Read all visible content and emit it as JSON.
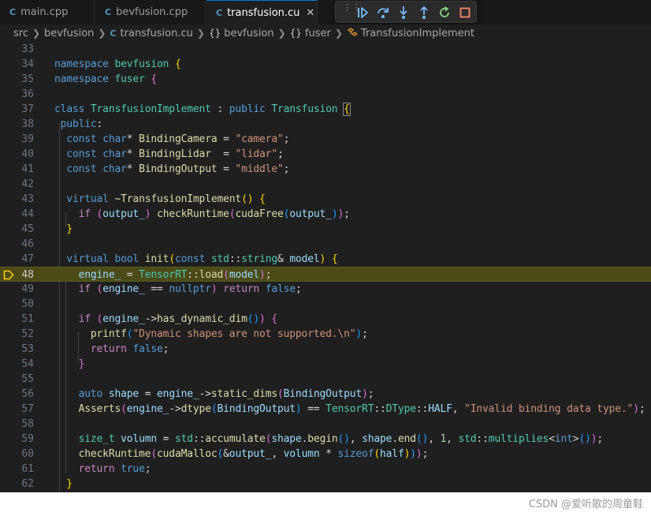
{
  "tabs": [
    {
      "label": "main.cpp",
      "icon": "c-icon",
      "active": false
    },
    {
      "label": "bevfusion.cpp",
      "icon": "c-icon",
      "active": false
    },
    {
      "label": "transfusion.cu",
      "icon": "c-icon",
      "active": true
    }
  ],
  "tab_close_glyph": "✕",
  "tab_icon_glyph": "C",
  "debug_toolbar": [
    "drag-handle-icon",
    "continue-icon",
    "step-over-icon",
    "step-into-icon",
    "step-out-icon",
    "restart-icon",
    "stop-icon"
  ],
  "breadcrumb": {
    "items": [
      "src",
      "bevfusion",
      "transfusion.cu",
      "bevfusion",
      "fuser",
      "TransfusionImplement"
    ],
    "namespace_glyph": "{}"
  },
  "editor": {
    "current_line": 48,
    "breakpoint_line": 48,
    "lines": [
      {
        "n": 33,
        "tokens": []
      },
      {
        "n": 34,
        "tokens": [
          [
            "namespace",
            "kw"
          ],
          [
            " ",
            ""
          ],
          [
            "bevfusion",
            "type"
          ],
          [
            " ",
            ""
          ],
          [
            "{",
            "b1"
          ]
        ]
      },
      {
        "n": 35,
        "tokens": [
          [
            "namespace",
            "kw"
          ],
          [
            " ",
            ""
          ],
          [
            "fuser",
            "type"
          ],
          [
            " ",
            ""
          ],
          [
            "{",
            "b2"
          ]
        ]
      },
      {
        "n": 36,
        "tokens": []
      },
      {
        "n": 37,
        "tokens": [
          [
            "class",
            "kw"
          ],
          [
            " ",
            ""
          ],
          [
            "TransfusionImplement",
            "type"
          ],
          [
            " : ",
            "op"
          ],
          [
            "public",
            "kw"
          ],
          [
            " ",
            ""
          ],
          [
            "Transfusion",
            "type"
          ],
          [
            " ",
            ""
          ],
          [
            "{",
            "match"
          ]
        ]
      },
      {
        "n": 38,
        "tokens": [
          [
            " ",
            ""
          ],
          [
            "public",
            "kw"
          ],
          [
            ":",
            "op"
          ]
        ]
      },
      {
        "n": 39,
        "tokens": [
          [
            "  ",
            ""
          ],
          [
            "const",
            "kw"
          ],
          [
            " ",
            ""
          ],
          [
            "char",
            "kw"
          ],
          [
            "* ",
            "op"
          ],
          [
            "BindingCamera",
            "fn"
          ],
          [
            " = ",
            "op"
          ],
          [
            "\"camera\"",
            "str"
          ],
          [
            ";",
            "op"
          ]
        ]
      },
      {
        "n": 40,
        "tokens": [
          [
            "  ",
            ""
          ],
          [
            "const",
            "kw"
          ],
          [
            " ",
            ""
          ],
          [
            "char",
            "kw"
          ],
          [
            "* ",
            "op"
          ],
          [
            "BindingLidar",
            "fn"
          ],
          [
            "  = ",
            "op"
          ],
          [
            "\"lidar\"",
            "str"
          ],
          [
            ";",
            "op"
          ]
        ]
      },
      {
        "n": 41,
        "tokens": [
          [
            "  ",
            ""
          ],
          [
            "const",
            "kw"
          ],
          [
            " ",
            ""
          ],
          [
            "char",
            "kw"
          ],
          [
            "* ",
            "op"
          ],
          [
            "BindingOutput",
            "fn"
          ],
          [
            " = ",
            "op"
          ],
          [
            "\"middle\"",
            "str"
          ],
          [
            ";",
            "op"
          ]
        ]
      },
      {
        "n": 42,
        "tokens": []
      },
      {
        "n": 43,
        "tokens": [
          [
            "  ",
            ""
          ],
          [
            "virtual",
            "kw"
          ],
          [
            " ",
            ""
          ],
          [
            "~TransfusionImplement",
            "fn"
          ],
          [
            "()",
            "b1"
          ],
          [
            " ",
            ""
          ],
          [
            "{",
            "b1"
          ]
        ]
      },
      {
        "n": 44,
        "tokens": [
          [
            "    ",
            ""
          ],
          [
            "if",
            "ctl"
          ],
          [
            " ",
            ""
          ],
          [
            "(",
            "b2"
          ],
          [
            "output_",
            "var"
          ],
          [
            ")",
            "b2"
          ],
          [
            " ",
            ""
          ],
          [
            "checkRuntime",
            "fn"
          ],
          [
            "(",
            "b2"
          ],
          [
            "cudaFree",
            "fn"
          ],
          [
            "(",
            "b3"
          ],
          [
            "output_",
            "var"
          ],
          [
            ")",
            "b3"
          ],
          [
            ")",
            "b2"
          ],
          [
            ";",
            "op"
          ]
        ]
      },
      {
        "n": 45,
        "tokens": [
          [
            "  ",
            ""
          ],
          [
            "}",
            "b1"
          ]
        ]
      },
      {
        "n": 46,
        "tokens": []
      },
      {
        "n": 47,
        "tokens": [
          [
            "  ",
            ""
          ],
          [
            "virtual",
            "kw"
          ],
          [
            " ",
            ""
          ],
          [
            "bool",
            "kw"
          ],
          [
            " ",
            ""
          ],
          [
            "init",
            "fn"
          ],
          [
            "(",
            "b1"
          ],
          [
            "const",
            "kw"
          ],
          [
            " ",
            ""
          ],
          [
            "std",
            "type"
          ],
          [
            "::",
            "op"
          ],
          [
            "string",
            "type"
          ],
          [
            "& ",
            "op"
          ],
          [
            "model",
            "var"
          ],
          [
            ")",
            "b1"
          ],
          [
            " ",
            ""
          ],
          [
            "{",
            "b1"
          ]
        ]
      },
      {
        "n": 48,
        "tokens": [
          [
            "    ",
            ""
          ],
          [
            "engine_",
            "var"
          ],
          [
            " = ",
            "op"
          ],
          [
            "TensorRT",
            "type"
          ],
          [
            "::",
            "op"
          ],
          [
            "load",
            "fn"
          ],
          [
            "(",
            "b2"
          ],
          [
            "model",
            "var"
          ],
          [
            ")",
            "b2"
          ],
          [
            ";",
            "op"
          ]
        ]
      },
      {
        "n": 49,
        "tokens": [
          [
            "    ",
            ""
          ],
          [
            "if",
            "ctl"
          ],
          [
            " ",
            ""
          ],
          [
            "(",
            "b2"
          ],
          [
            "engine_",
            "var"
          ],
          [
            " == ",
            "op"
          ],
          [
            "nullptr",
            "kw"
          ],
          [
            ")",
            "b2"
          ],
          [
            " ",
            ""
          ],
          [
            "return",
            "ctl"
          ],
          [
            " ",
            ""
          ],
          [
            "false",
            "kw"
          ],
          [
            ";",
            "op"
          ]
        ]
      },
      {
        "n": 50,
        "tokens": []
      },
      {
        "n": 51,
        "tokens": [
          [
            "    ",
            ""
          ],
          [
            "if",
            "ctl"
          ],
          [
            " ",
            ""
          ],
          [
            "(",
            "b2"
          ],
          [
            "engine_",
            "var"
          ],
          [
            "->",
            "op"
          ],
          [
            "has_dynamic_dim",
            "fn"
          ],
          [
            "()",
            "b3"
          ],
          [
            ")",
            "b2"
          ],
          [
            " ",
            ""
          ],
          [
            "{",
            "b2"
          ]
        ]
      },
      {
        "n": 52,
        "tokens": [
          [
            "      ",
            ""
          ],
          [
            "printf",
            "fn"
          ],
          [
            "(",
            "b3"
          ],
          [
            "\"Dynamic shapes are not supported.\\n\"",
            "str"
          ],
          [
            ")",
            "b3"
          ],
          [
            ";",
            "op"
          ]
        ]
      },
      {
        "n": 53,
        "tokens": [
          [
            "      ",
            ""
          ],
          [
            "return",
            "ctl"
          ],
          [
            " ",
            ""
          ],
          [
            "false",
            "kw"
          ],
          [
            ";",
            "op"
          ]
        ]
      },
      {
        "n": 54,
        "tokens": [
          [
            "    ",
            ""
          ],
          [
            "}",
            "b2"
          ]
        ]
      },
      {
        "n": 55,
        "tokens": []
      },
      {
        "n": 56,
        "tokens": [
          [
            "    ",
            ""
          ],
          [
            "auto",
            "kw"
          ],
          [
            " ",
            ""
          ],
          [
            "shape",
            "var"
          ],
          [
            " = ",
            "op"
          ],
          [
            "engine_",
            "var"
          ],
          [
            "->",
            "op"
          ],
          [
            "static_dims",
            "fn"
          ],
          [
            "(",
            "b2"
          ],
          [
            "BindingOutput",
            "var"
          ],
          [
            ")",
            "b2"
          ],
          [
            ";",
            "op"
          ]
        ]
      },
      {
        "n": 57,
        "tokens": [
          [
            "    ",
            ""
          ],
          [
            "Asserts",
            "fn"
          ],
          [
            "(",
            "b2"
          ],
          [
            "engine_",
            "var"
          ],
          [
            "->",
            "op"
          ],
          [
            "dtype",
            "fn"
          ],
          [
            "(",
            "b3"
          ],
          [
            "BindingOutput",
            "var"
          ],
          [
            ")",
            "b3"
          ],
          [
            " == ",
            "op"
          ],
          [
            "TensorRT",
            "type"
          ],
          [
            "::",
            "op"
          ],
          [
            "DType",
            "type"
          ],
          [
            "::",
            "op"
          ],
          [
            "HALF",
            "var"
          ],
          [
            ", ",
            "op"
          ],
          [
            "\"Invalid binding data type.\"",
            "str"
          ],
          [
            ")",
            "b2"
          ],
          [
            ";",
            "op"
          ]
        ]
      },
      {
        "n": 58,
        "tokens": []
      },
      {
        "n": 59,
        "tokens": [
          [
            "    ",
            ""
          ],
          [
            "size_t",
            "type"
          ],
          [
            " ",
            ""
          ],
          [
            "volumn",
            "var"
          ],
          [
            " = ",
            "op"
          ],
          [
            "std",
            "type"
          ],
          [
            "::",
            "op"
          ],
          [
            "accumulate",
            "fn"
          ],
          [
            "(",
            "b2"
          ],
          [
            "shape",
            "var"
          ],
          [
            ".",
            "op"
          ],
          [
            "begin",
            "fn"
          ],
          [
            "()",
            "b3"
          ],
          [
            ", ",
            "op"
          ],
          [
            "shape",
            "var"
          ],
          [
            ".",
            "op"
          ],
          [
            "end",
            "fn"
          ],
          [
            "()",
            "b3"
          ],
          [
            ", ",
            "op"
          ],
          [
            "1",
            "num"
          ],
          [
            ", ",
            "op"
          ],
          [
            "std",
            "type"
          ],
          [
            "::",
            "op"
          ],
          [
            "multiplies",
            "type"
          ],
          [
            "<",
            "op"
          ],
          [
            "int",
            "kw"
          ],
          [
            ">",
            "op"
          ],
          [
            "()",
            "b3"
          ],
          [
            ")",
            "b2"
          ],
          [
            ";",
            "op"
          ]
        ]
      },
      {
        "n": 60,
        "tokens": [
          [
            "    ",
            ""
          ],
          [
            "checkRuntime",
            "fn"
          ],
          [
            "(",
            "b2"
          ],
          [
            "cudaMalloc",
            "fn"
          ],
          [
            "(",
            "b3"
          ],
          [
            "&",
            "op"
          ],
          [
            "output_",
            "var"
          ],
          [
            ", ",
            "op"
          ],
          [
            "volumn",
            "var"
          ],
          [
            " * ",
            "op"
          ],
          [
            "sizeof",
            "kw"
          ],
          [
            "(",
            "b1"
          ],
          [
            "half",
            "var"
          ],
          [
            ")",
            "b1"
          ],
          [
            ")",
            "b3"
          ],
          [
            ")",
            "b2"
          ],
          [
            ";",
            "op"
          ]
        ]
      },
      {
        "n": 61,
        "tokens": [
          [
            "    ",
            ""
          ],
          [
            "return",
            "ctl"
          ],
          [
            " ",
            ""
          ],
          [
            "true",
            "kw"
          ],
          [
            ";",
            "op"
          ]
        ]
      },
      {
        "n": 62,
        "tokens": [
          [
            "  ",
            ""
          ],
          [
            "}",
            "b1"
          ]
        ]
      }
    ]
  },
  "watermark": "CSDN @爱听歌的周童鞋",
  "colors": {
    "background": "#1f1f1f",
    "tabbar": "#181818",
    "current_line": "#4b4b18",
    "breakpoint": "#ffcc00",
    "accent": "#0078d4"
  }
}
